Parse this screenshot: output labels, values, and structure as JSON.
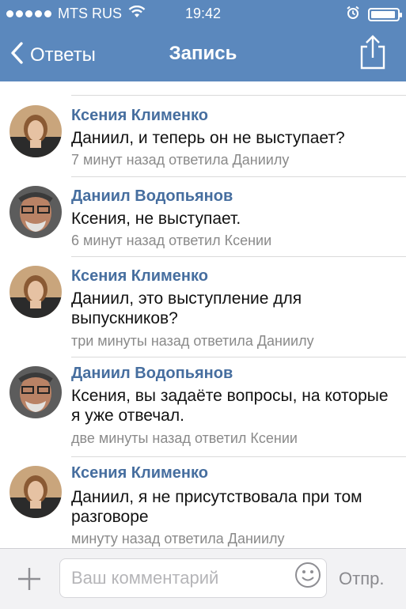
{
  "status_bar": {
    "carrier": "MTS RUS",
    "time": "19:42",
    "wifi_icon": "wifi-icon",
    "alarm_icon": "alarm-icon",
    "battery_icon": "battery-icon",
    "battery_level": 0.95,
    "signal_bars": 5
  },
  "nav": {
    "back_label": "Ответы",
    "title": "Запись",
    "back_icon": "chevron-left-icon",
    "share_icon": "share-icon"
  },
  "comments": [
    {
      "author": "Ксения Клименко",
      "text": "Даниил, и теперь он не выступает?",
      "meta": "7 минут назад ответила Даниилу",
      "avatar": "ksenia-avatar"
    },
    {
      "author": "Даниил Водопьянов",
      "text": "Ксения, не выступает.",
      "meta": "6 минут назад ответил Ксении",
      "avatar": "daniil-avatar"
    },
    {
      "author": "Ксения Клименко",
      "text": "Даниил, это выступление для выпускников?",
      "meta": "три минуты назад ответила Даниилу",
      "avatar": "ksenia-avatar"
    },
    {
      "author": "Даниил Водопьянов",
      "text": "Ксения, вы задаёте вопросы, на которые я уже отвечал.",
      "meta": "две минуты назад ответил Ксении",
      "avatar": "daniil-avatar"
    },
    {
      "author": "Ксения Клименко",
      "text": "Даниил, я не присутствовала при том разговоре",
      "meta": "минуту назад ответила Даниилу",
      "avatar": "ksenia-avatar"
    }
  ],
  "input_bar": {
    "placeholder": "Ваш комментарий",
    "value": "",
    "send_label": "Отпр.",
    "plus_icon": "plus-icon",
    "emoji_icon": "smiley-icon"
  },
  "colors": {
    "header_bg": "#5b88bd",
    "author_name": "#466e9f",
    "meta_text": "#8a8a8a",
    "input_bar_bg": "#f2f2f4"
  }
}
